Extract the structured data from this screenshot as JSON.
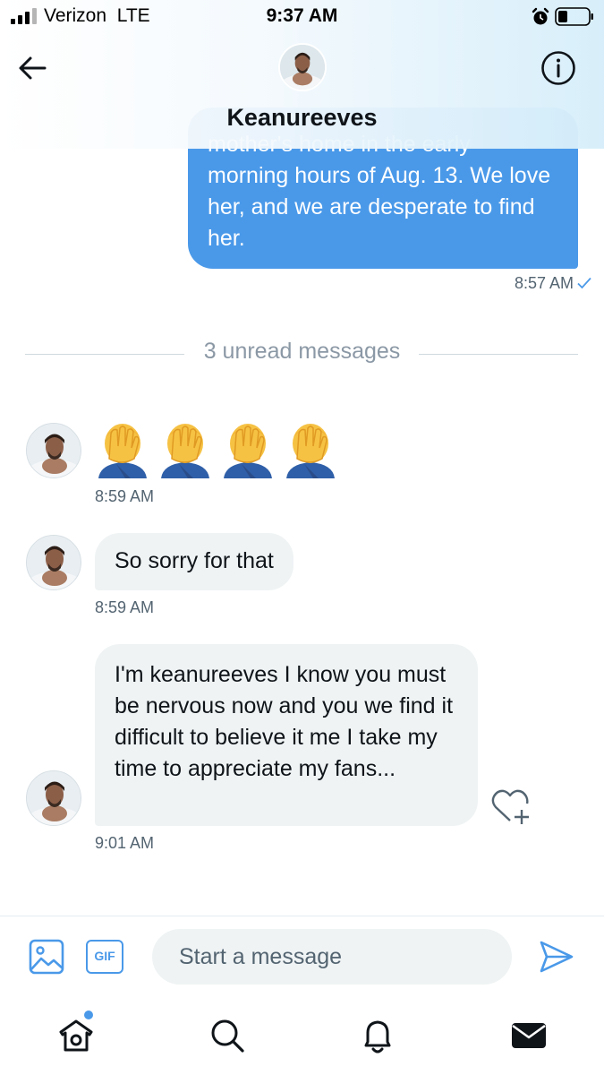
{
  "status_bar": {
    "carrier": "Verizon",
    "network": "LTE",
    "time": "9:37 AM"
  },
  "header": {
    "name": "Keanureeves"
  },
  "messages": {
    "sent": {
      "partial_line": "mother's home in the early",
      "text": "morning hours of Aug. 13. We love her, and we are desperate to find her.",
      "time": "8:57 AM"
    },
    "divider": "3 unread messages",
    "received": [
      {
        "emoji": "facepalm",
        "count": 4,
        "time": "8:59 AM"
      },
      {
        "text": "So sorry for that",
        "time": "8:59 AM"
      },
      {
        "text": "I'm keanureeves I know you must be nervous now and you we find it difficult to believe it me I take my time to appreciate my fans...",
        "time": "9:01 AM"
      }
    ]
  },
  "composer": {
    "gif_label": "GIF",
    "placeholder": "Start a message"
  },
  "tabbar": {
    "items": [
      "home-icon",
      "search-icon",
      "notifications-icon",
      "messages-icon"
    ],
    "home_has_new": true
  },
  "colors": {
    "accent": "#4a99e9",
    "sent_bubble": "#4a99e9",
    "received_bubble": "#eff3f4",
    "secondary_text": "#536471"
  }
}
